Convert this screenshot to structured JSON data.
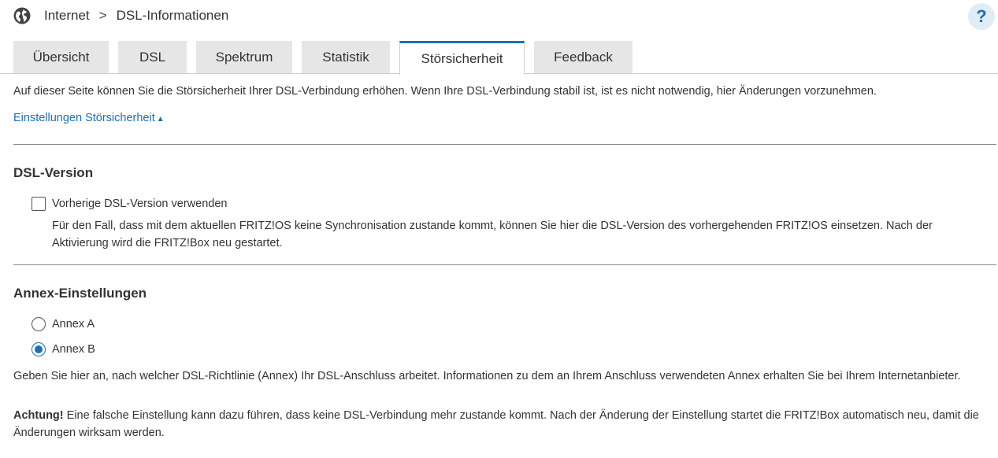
{
  "breadcrumb": {
    "icon": "globe-icon",
    "parent": "Internet",
    "separator": ">",
    "current": "DSL-Informationen"
  },
  "help": {
    "label": "?",
    "icon": "help-icon"
  },
  "tabs": [
    {
      "label": "Übersicht",
      "active": false
    },
    {
      "label": "DSL",
      "active": false
    },
    {
      "label": "Spektrum",
      "active": false
    },
    {
      "label": "Statistik",
      "active": false
    },
    {
      "label": "Störsicherheit",
      "active": true
    },
    {
      "label": "Feedback",
      "active": false
    }
  ],
  "intro_text": "Auf dieser Seite können Sie die Störsicherheit Ihrer DSL-Verbindung erhöhen. Wenn Ihre DSL-Verbindung stabil ist, ist es nicht notwendig, hier Änderungen vorzunehmen.",
  "settings_link": {
    "label": "Einstellungen Störsicherheit",
    "icon": "triangle-up-icon"
  },
  "dsl_version": {
    "title": "DSL-Version",
    "checkbox_label": "Vorherige DSL-Version verwenden",
    "checked": false,
    "description": "Für den Fall, dass mit dem aktuellen FRITZ!OS keine Synchronisation zustande kommt, können Sie hier die DSL-Version des vorhergehenden FRITZ!OS einsetzen. Nach der Aktivierung wird die FRITZ!Box neu gestartet."
  },
  "annex": {
    "title": "Annex-Einstellungen",
    "options": [
      {
        "label": "Annex A",
        "selected": false
      },
      {
        "label": "Annex B",
        "selected": true
      }
    ],
    "info": "Geben Sie hier an, nach welcher DSL-Richtlinie (Annex) Ihr DSL-Anschluss arbeitet. Informationen zu dem an Ihrem Anschluss verwendeten Annex erhalten Sie bei Ihrem Internetanbieter.",
    "warning_label": "Achtung!",
    "warning_text": " Eine falsche Einstellung kann dazu führen, dass keine DSL-Verbindung mehr zustande kommt. Nach der Änderung der Einstellung startet die FRITZ!Box automatisch neu, damit die Änderungen wirksam werden."
  },
  "colors": {
    "accent": "#1a6fb8",
    "tab_bg": "#e6e6e6",
    "text": "#333333"
  }
}
